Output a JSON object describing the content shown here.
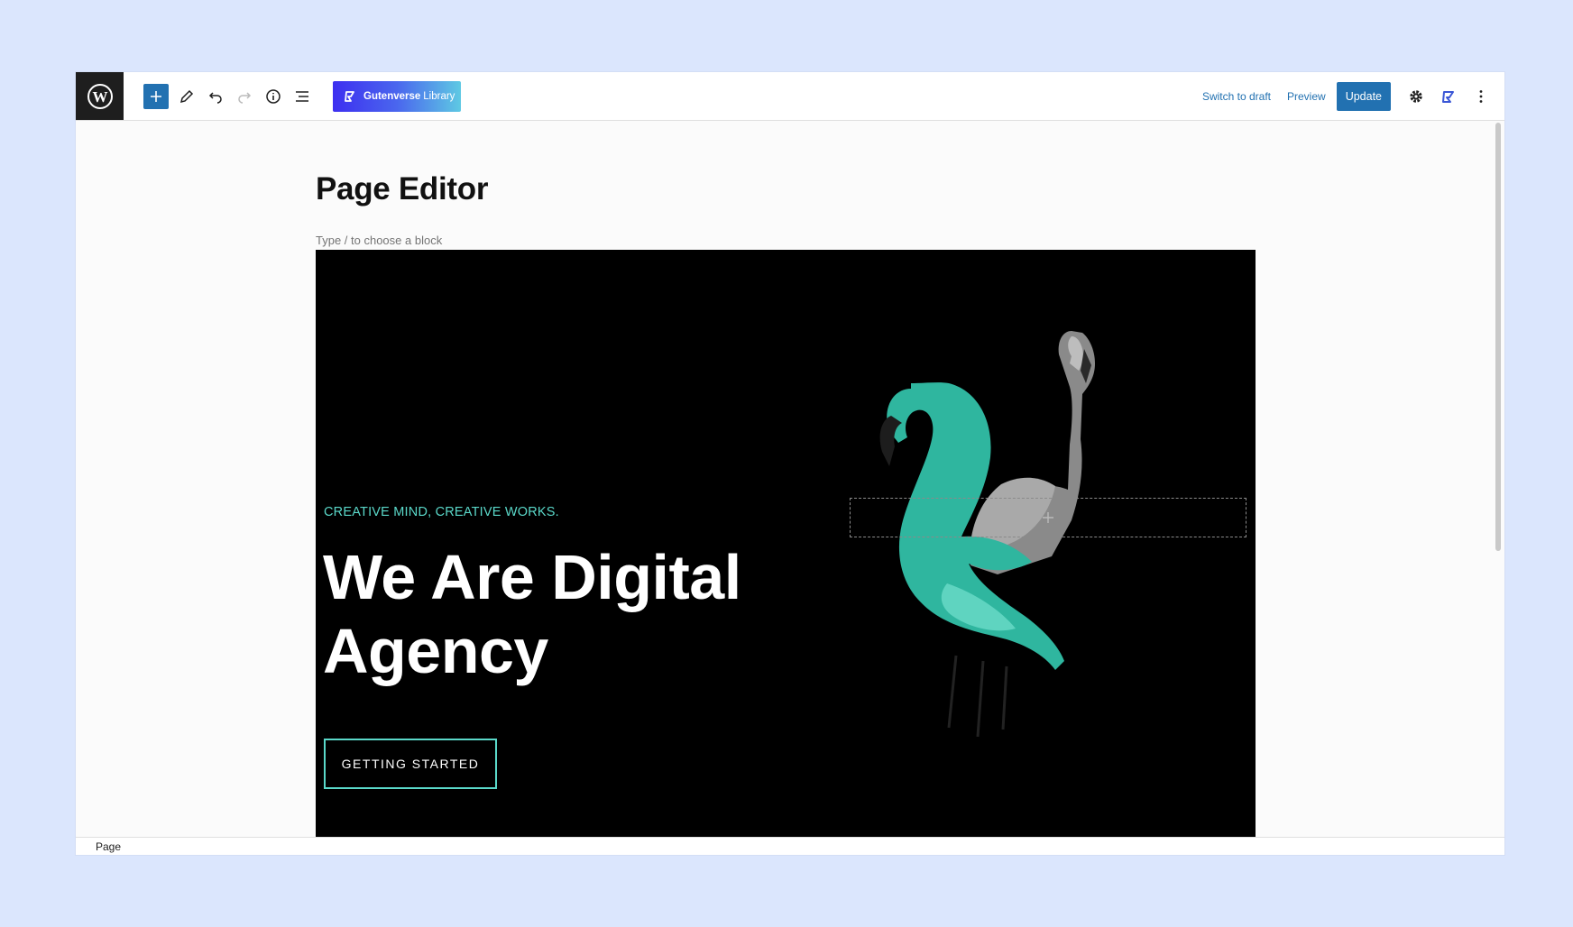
{
  "toolbar": {
    "library_label_bold": "Gutenverse",
    "library_label_light": "Library",
    "switch_to_draft": "Switch to draft",
    "preview": "Preview",
    "update": "Update"
  },
  "editor": {
    "title": "Page Editor",
    "block_placeholder": "Type / to choose a block"
  },
  "hero": {
    "subtitle": "CREATIVE MIND, CREATIVE WORKS.",
    "heading": "We Are Digital Agency",
    "button": "GETTING STARTED"
  },
  "footer": {
    "breadcrumb": "Page"
  },
  "colors": {
    "accent": "#2271b1",
    "teal": "#5ad8c9",
    "topbar_logo_bg": "#1e1e1e",
    "hero_bg": "#000000"
  },
  "icons": [
    "wordpress-logo",
    "plus-icon",
    "pencil-icon",
    "undo-icon",
    "redo-icon",
    "info-icon",
    "list-view-icon",
    "gutenverse-icon",
    "gear-icon",
    "kebab-menu-icon"
  ]
}
